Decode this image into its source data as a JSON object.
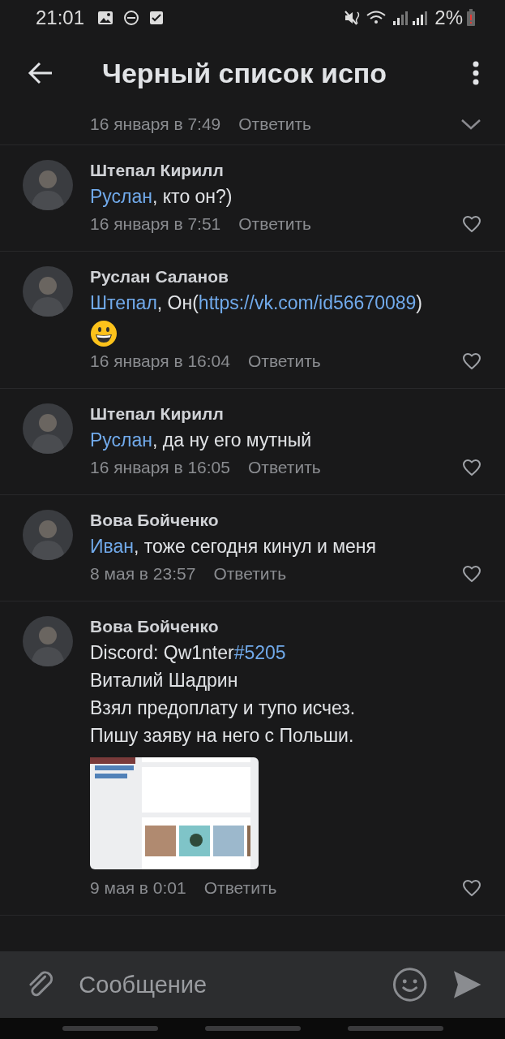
{
  "status_bar": {
    "time": "21:01",
    "battery": "2%"
  },
  "header": {
    "title": "Черный список испо"
  },
  "previous_comment": {
    "date": "16 января в 7:49",
    "reply": "Ответить"
  },
  "comments": [
    {
      "author": "Штепал Кирилл",
      "lines": [
        [
          {
            "kind": "mention",
            "text": "Руслан"
          },
          {
            "kind": "plain",
            "text": ", кто он?)"
          }
        ]
      ],
      "date": "16 января в 7:51",
      "reply": "Ответить",
      "liked": false
    },
    {
      "author": "Руслан Саланов",
      "lines": [
        [
          {
            "kind": "mention",
            "text": "Штепал"
          },
          {
            "kind": "plain",
            "text": ", Он("
          },
          {
            "kind": "link",
            "text": "https://vk.com/id56670089"
          },
          {
            "kind": "plain",
            "text": ")"
          }
        ],
        [
          {
            "kind": "emoji"
          }
        ]
      ],
      "date": "16 января в 16:04",
      "reply": "Ответить",
      "liked": false
    },
    {
      "author": "Штепал Кирилл",
      "lines": [
        [
          {
            "kind": "mention",
            "text": "Руслан"
          },
          {
            "kind": "plain",
            "text": ", да ну его мутный"
          }
        ]
      ],
      "date": "16 января в 16:05",
      "reply": "Ответить",
      "liked": false
    },
    {
      "author": "Вова Бойченко",
      "lines": [
        [
          {
            "kind": "mention",
            "text": "Иван"
          },
          {
            "kind": "plain",
            "text": ", тоже сегодня кинул и меня"
          }
        ]
      ],
      "date": "8 мая в 23:57",
      "reply": "Ответить",
      "liked": false
    },
    {
      "author": "Вова Бойченко",
      "lines": [
        [
          {
            "kind": "plain",
            "text": "Discord: Qw1nter"
          },
          {
            "kind": "hashtag",
            "text": "#5205"
          }
        ],
        [
          {
            "kind": "plain",
            "text": "Виталий Шадрин"
          }
        ],
        [
          {
            "kind": "plain",
            "text": "Взял предоплату и тупо исчез."
          }
        ],
        [
          {
            "kind": "plain",
            "text": "Пишу заяву на него с Польши."
          }
        ]
      ],
      "attachment": {
        "kind": "picture"
      },
      "date": "9 мая в 0:01",
      "reply": "Ответить",
      "liked": false
    }
  ],
  "composer": {
    "placeholder": "Сообщение"
  }
}
